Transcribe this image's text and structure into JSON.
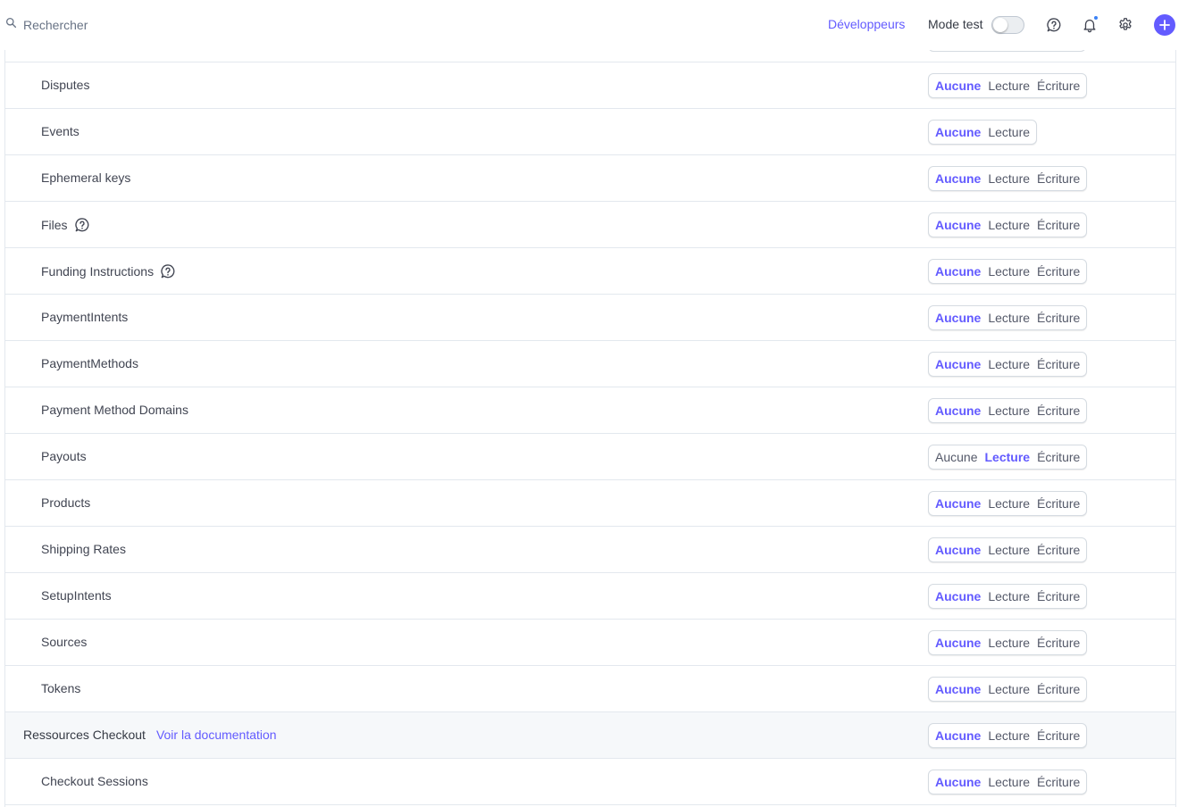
{
  "topbar": {
    "search_placeholder": "Rechercher",
    "developers_link": "Développeurs",
    "mode_test_label": "Mode test",
    "icons": [
      "search-icon",
      "help-icon",
      "bell-icon",
      "gear-icon",
      "plus-icon"
    ],
    "accent_color": "#635bff"
  },
  "permissions": {
    "options": [
      "Aucune",
      "Lecture",
      "Écriture"
    ],
    "rows": [
      {
        "name": "Disputes",
        "options": [
          "Aucune",
          "Lecture",
          "Écriture"
        ],
        "selected": "Aucune",
        "help_icon": false
      },
      {
        "name": "Events",
        "options": [
          "Aucune",
          "Lecture"
        ],
        "selected": "Aucune",
        "help_icon": false
      },
      {
        "name": "Ephemeral keys",
        "options": [
          "Aucune",
          "Lecture",
          "Écriture"
        ],
        "selected": "Aucune",
        "help_icon": false
      },
      {
        "name": "Files",
        "options": [
          "Aucune",
          "Lecture",
          "Écriture"
        ],
        "selected": "Aucune",
        "help_icon": true
      },
      {
        "name": "Funding Instructions",
        "options": [
          "Aucune",
          "Lecture",
          "Écriture"
        ],
        "selected": "Aucune",
        "help_icon": true
      },
      {
        "name": "PaymentIntents",
        "options": [
          "Aucune",
          "Lecture",
          "Écriture"
        ],
        "selected": "Aucune",
        "help_icon": false
      },
      {
        "name": "PaymentMethods",
        "options": [
          "Aucune",
          "Lecture",
          "Écriture"
        ],
        "selected": "Aucune",
        "help_icon": false
      },
      {
        "name": "Payment Method Domains",
        "options": [
          "Aucune",
          "Lecture",
          "Écriture"
        ],
        "selected": "Aucune",
        "help_icon": false
      },
      {
        "name": "Payouts",
        "options": [
          "Aucune",
          "Lecture",
          "Écriture"
        ],
        "selected": "Lecture",
        "help_icon": false
      },
      {
        "name": "Products",
        "options": [
          "Aucune",
          "Lecture",
          "Écriture"
        ],
        "selected": "Aucune",
        "help_icon": false
      },
      {
        "name": "Shipping Rates",
        "options": [
          "Aucune",
          "Lecture",
          "Écriture"
        ],
        "selected": "Aucune",
        "help_icon": false
      },
      {
        "name": "SetupIntents",
        "options": [
          "Aucune",
          "Lecture",
          "Écriture"
        ],
        "selected": "Aucune",
        "help_icon": false
      },
      {
        "name": "Sources",
        "options": [
          "Aucune",
          "Lecture",
          "Écriture"
        ],
        "selected": "Aucune",
        "help_icon": false
      },
      {
        "name": "Tokens",
        "options": [
          "Aucune",
          "Lecture",
          "Écriture"
        ],
        "selected": "Aucune",
        "help_icon": false
      },
      {
        "name": "Ressources Checkout",
        "section": true,
        "doc_link": "Voir la documentation",
        "options": [
          "Aucune",
          "Lecture",
          "Écriture"
        ],
        "selected": "Aucune",
        "help_icon": false
      },
      {
        "name": "Checkout Sessions",
        "options": [
          "Aucune",
          "Lecture",
          "Écriture"
        ],
        "selected": "Aucune",
        "help_icon": false
      }
    ]
  }
}
